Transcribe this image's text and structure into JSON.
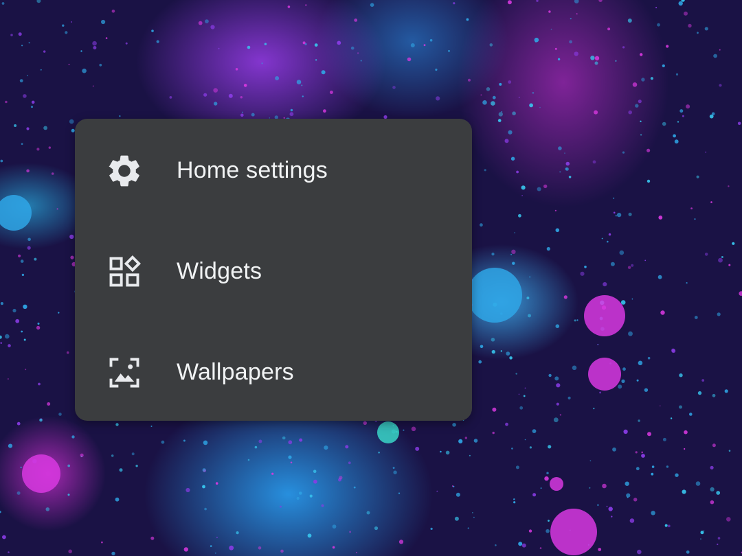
{
  "wallpaper": {
    "colors": {
      "base": "#1a1245",
      "magenta": "#d838e0",
      "cyan": "#2fa6e6",
      "violet": "#8a3ce6"
    }
  },
  "popup_menu": {
    "background_color": "#3b3d3f",
    "text_color": "#f1f3f4",
    "items": [
      {
        "label": "Home settings",
        "icon": "gear-icon"
      },
      {
        "label": "Widgets",
        "icon": "widgets-icon"
      },
      {
        "label": "Wallpapers",
        "icon": "wallpaper-icon"
      }
    ]
  }
}
